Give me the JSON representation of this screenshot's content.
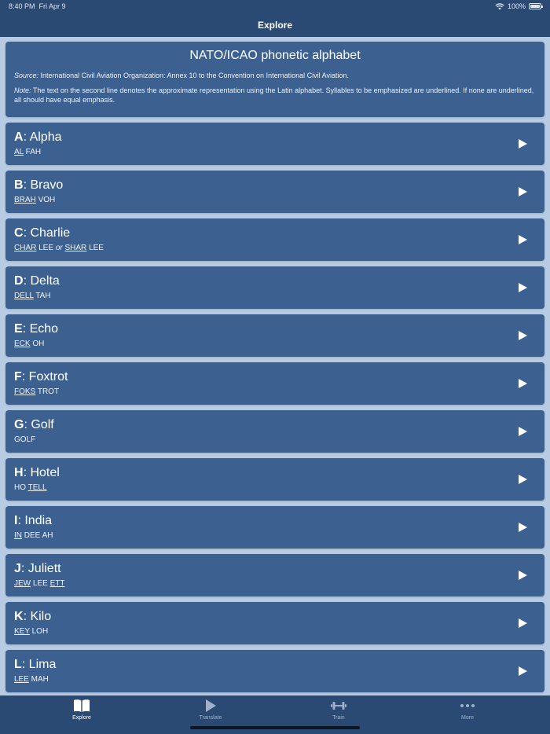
{
  "status": {
    "time": "8:40 PM",
    "date": "Fri Apr 9",
    "battery": "100%"
  },
  "nav": {
    "title": "Explore"
  },
  "intro": {
    "title": "NATO/ICAO phonetic alphabet",
    "source_label": "Source:",
    "source_text": "International Civil Aviation Organization: Annex 10 to the Convention on International Civil Aviation.",
    "note_label": "Note:",
    "note_text": "The text on the second line denotes the approximate representation using the Latin alphabet. Syllables to be emphasized are underlined. If none are underlined, all should have equal emphasis."
  },
  "letters": [
    {
      "letter": "A",
      "word": "Alpha",
      "pron": [
        {
          "t": "AL",
          "u": true
        },
        {
          "t": " FAH"
        }
      ]
    },
    {
      "letter": "B",
      "word": "Bravo",
      "pron": [
        {
          "t": "BRAH",
          "u": true
        },
        {
          "t": " VOH"
        }
      ]
    },
    {
      "letter": "C",
      "word": "Charlie",
      "pron": [
        {
          "t": "CHAR",
          "u": true
        },
        {
          "t": " LEE "
        },
        {
          "t": "or",
          "i": true
        },
        {
          "t": " "
        },
        {
          "t": "SHAR",
          "u": true
        },
        {
          "t": " LEE"
        }
      ]
    },
    {
      "letter": "D",
      "word": "Delta",
      "pron": [
        {
          "t": "DELL",
          "u": true
        },
        {
          "t": " TAH"
        }
      ]
    },
    {
      "letter": "E",
      "word": "Echo",
      "pron": [
        {
          "t": "ECK",
          "u": true
        },
        {
          "t": " OH"
        }
      ]
    },
    {
      "letter": "F",
      "word": "Foxtrot",
      "pron": [
        {
          "t": "FOKS",
          "u": true
        },
        {
          "t": " TROT"
        }
      ]
    },
    {
      "letter": "G",
      "word": "Golf",
      "pron": [
        {
          "t": "GOLF"
        }
      ]
    },
    {
      "letter": "H",
      "word": "Hotel",
      "pron": [
        {
          "t": "HO "
        },
        {
          "t": "TELL",
          "u": true
        }
      ]
    },
    {
      "letter": "I",
      "word": "India",
      "pron": [
        {
          "t": "IN",
          "u": true
        },
        {
          "t": " DEE AH"
        }
      ]
    },
    {
      "letter": "J",
      "word": "Juliett",
      "pron": [
        {
          "t": "JEW",
          "u": true
        },
        {
          "t": " LEE "
        },
        {
          "t": "ETT",
          "u": true
        }
      ]
    },
    {
      "letter": "K",
      "word": "Kilo",
      "pron": [
        {
          "t": "KEY",
          "u": true
        },
        {
          "t": " LOH"
        }
      ]
    },
    {
      "letter": "L",
      "word": "Lima",
      "pron": [
        {
          "t": "LEE",
          "u": true
        },
        {
          "t": " MAH"
        }
      ]
    }
  ],
  "tabs": [
    {
      "label": "Explore",
      "icon": "book-icon",
      "active": true
    },
    {
      "label": "Translate",
      "icon": "play-icon",
      "active": false
    },
    {
      "label": "Train",
      "icon": "dumbbell-icon",
      "active": false
    },
    {
      "label": "More",
      "icon": "more-dots-icon",
      "active": false
    }
  ],
  "colors": {
    "bar": "#2a4a74",
    "card": "#3c6190",
    "background": "#b7cbe2",
    "inactive_tab": "#9fb1c8"
  }
}
